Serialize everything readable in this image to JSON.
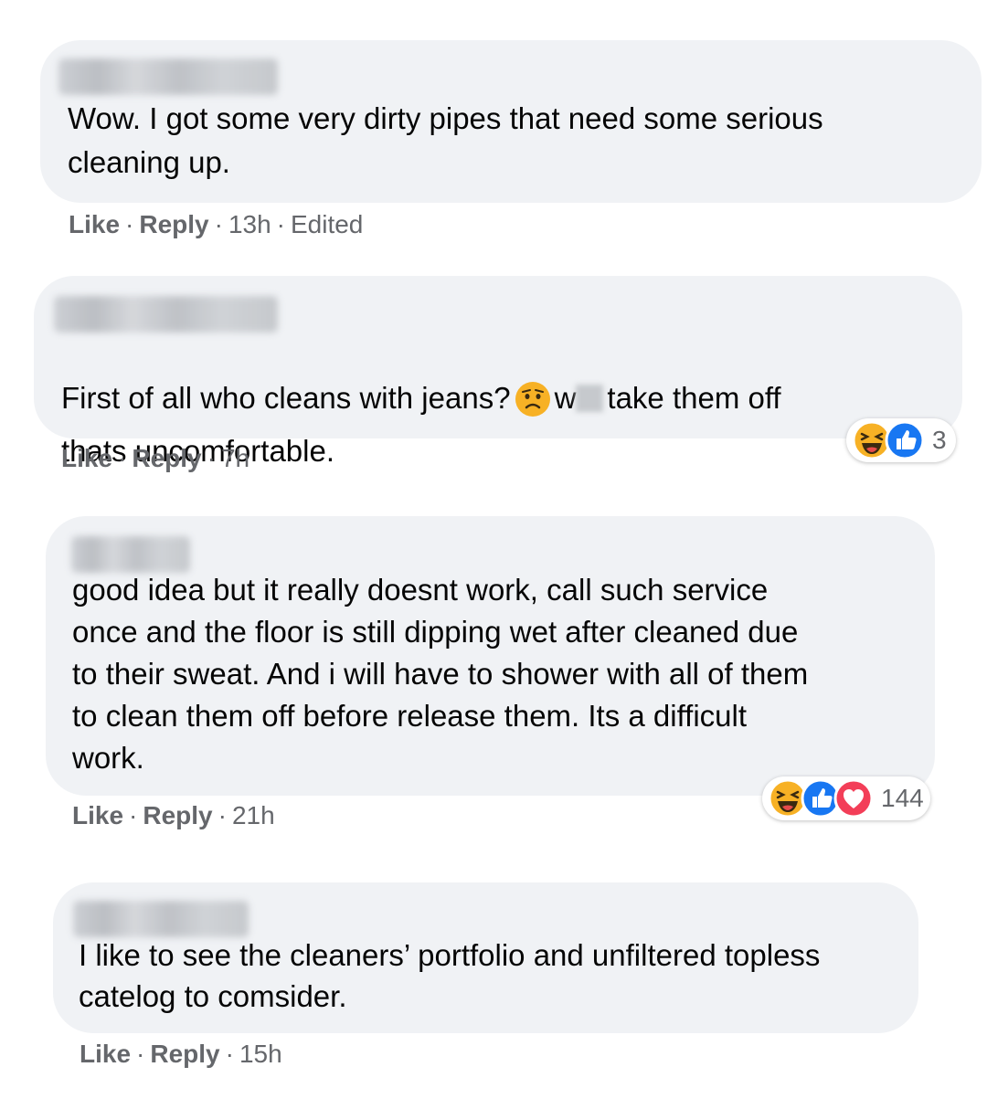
{
  "comments": [
    {
      "text": "Wow. I got some very dirty pipes that need some serious\ncleaning up.",
      "actions": {
        "like": "Like",
        "reply": "Reply",
        "time": "13h",
        "edited": "Edited"
      }
    },
    {
      "text_part1": "First of all who cleans with jeans?",
      "text_part2": "w",
      "text_part3": "take them off",
      "text_line2": "thats uncomfortable.",
      "actions": {
        "like": "Like",
        "reply": "Reply",
        "time": "7h"
      },
      "reactions": {
        "icons": [
          "haha-icon",
          "like-icon"
        ],
        "count": "3"
      }
    },
    {
      "text": "good idea but it really doesnt work, call such service\nonce and the floor is still dipping wet after cleaned due\nto their sweat. And i will have to shower with all of them\nto clean them off before release them. Its a difficult\nwork.",
      "actions": {
        "like": "Like",
        "reply": "Reply",
        "time": "21h"
      },
      "reactions": {
        "icons": [
          "haha-icon",
          "like-icon",
          "love-icon"
        ],
        "count": "144"
      }
    },
    {
      "text": "I like to see the cleaners’ portfolio and unfiltered topless\ncatelog to comsider.",
      "actions": {
        "like": "Like",
        "reply": "Reply",
        "time": "15h"
      }
    }
  ],
  "separator": "·",
  "colors": {
    "bubble": "#f0f2f5",
    "text": "#050505",
    "meta": "#65676b",
    "like_blue": "#1877f2",
    "love_red": "#f33e58",
    "haha_yellow": "#f7b125"
  }
}
